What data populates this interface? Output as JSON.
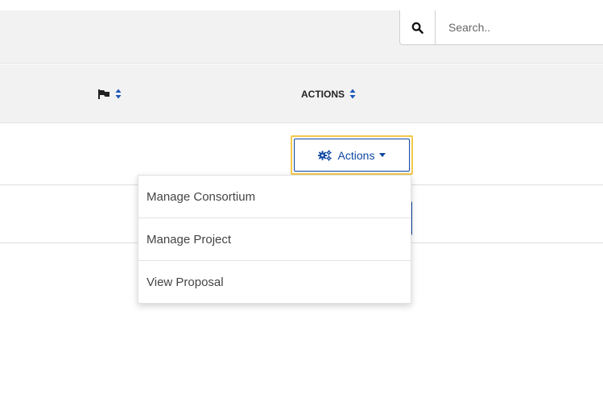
{
  "search": {
    "placeholder": "Search.."
  },
  "table": {
    "columns": [
      {
        "header": "",
        "icon": "flag-icon"
      },
      {
        "header": "ACTIONS"
      }
    ]
  },
  "actions_button": {
    "label": "Actions",
    "icon": "gears-icon"
  },
  "dropdown": {
    "items": [
      {
        "label": "Manage Consortium"
      },
      {
        "label": "Manage Project"
      },
      {
        "label": "View Proposal"
      }
    ]
  },
  "colors": {
    "accent": "#0e47a1",
    "focus": "#f2c94c",
    "header_bg": "#f2f2f2"
  }
}
